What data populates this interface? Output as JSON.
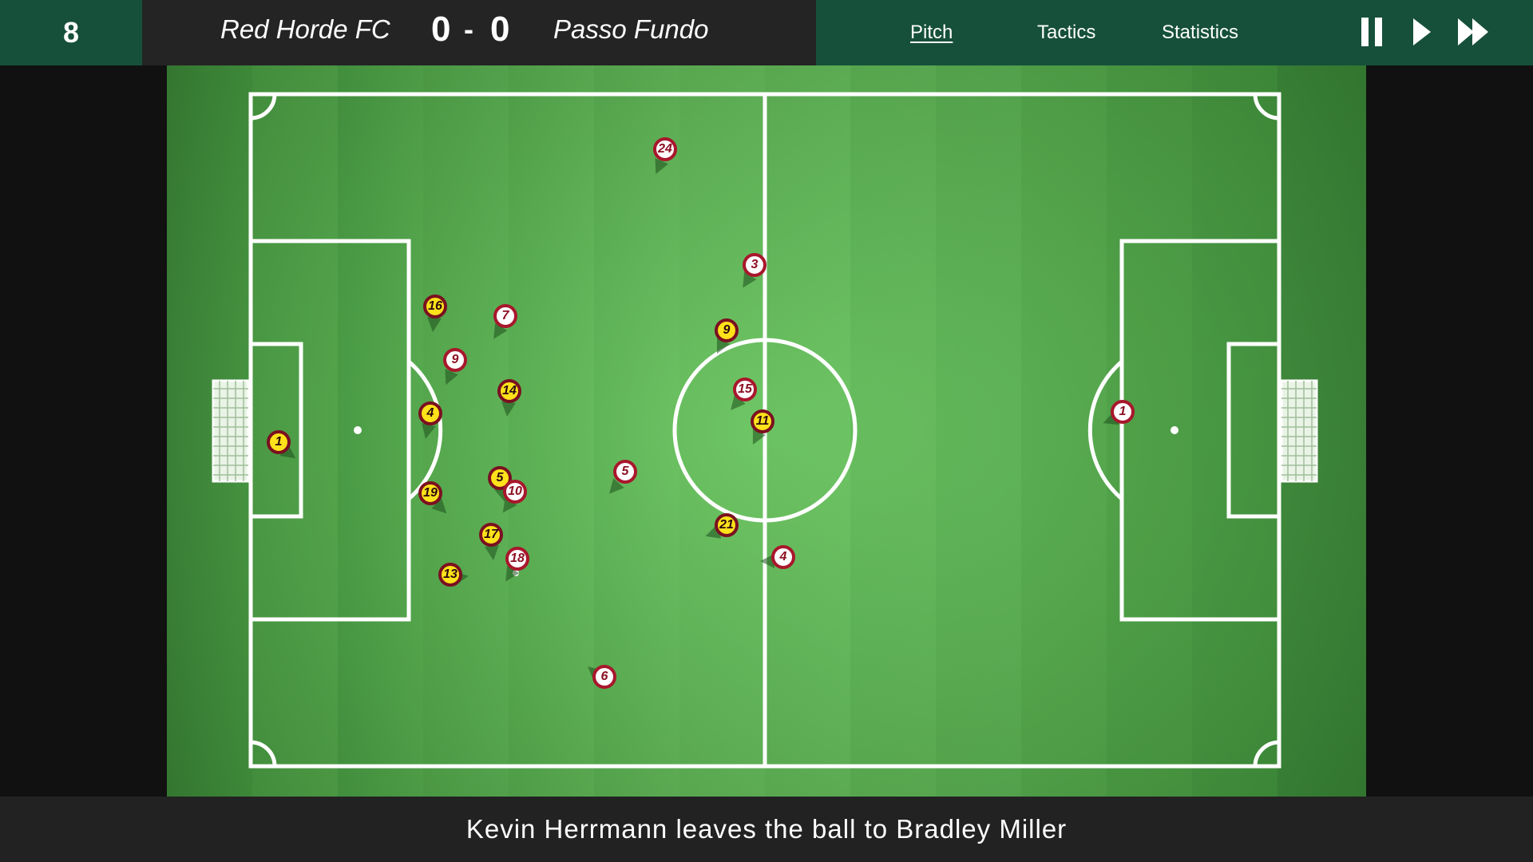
{
  "match": {
    "minute": "8",
    "home_team": "Red Horde FC",
    "home_score": "0",
    "score_separator": "-",
    "away_score": "0",
    "away_team": "Passo Fundo"
  },
  "nav": {
    "tabs": [
      {
        "label": "Pitch",
        "active": true
      },
      {
        "label": "Tactics",
        "active": false
      },
      {
        "label": "Statistics",
        "active": false
      }
    ]
  },
  "controls": {
    "pause_icon": "pause-icon",
    "play_icon": "play-icon",
    "fast_forward_icon": "fast-forward-icon"
  },
  "colors": {
    "topbar": "#16503a",
    "scoreboard": "#242424",
    "home_kit_fill": "#ffe21a",
    "home_kit_border": "#7a1020",
    "away_kit_fill": "#ffffff",
    "away_kit_border": "#a8172c"
  },
  "players": {
    "home": [
      {
        "number": "1"
      },
      {
        "number": "16"
      },
      {
        "number": "4"
      },
      {
        "number": "19"
      },
      {
        "number": "13"
      },
      {
        "number": "14"
      },
      {
        "number": "5"
      },
      {
        "number": "17"
      },
      {
        "number": "9"
      },
      {
        "number": "11"
      },
      {
        "number": "21"
      }
    ],
    "away": [
      {
        "number": "24"
      },
      {
        "number": "7"
      },
      {
        "number": "9"
      },
      {
        "number": "10"
      },
      {
        "number": "18"
      },
      {
        "number": "5"
      },
      {
        "number": "6"
      },
      {
        "number": "3"
      },
      {
        "number": "15"
      },
      {
        "number": "4"
      },
      {
        "number": "1"
      }
    ]
  },
  "commentary": "Kevin Herrmann leaves the ball to Bradley Miller"
}
